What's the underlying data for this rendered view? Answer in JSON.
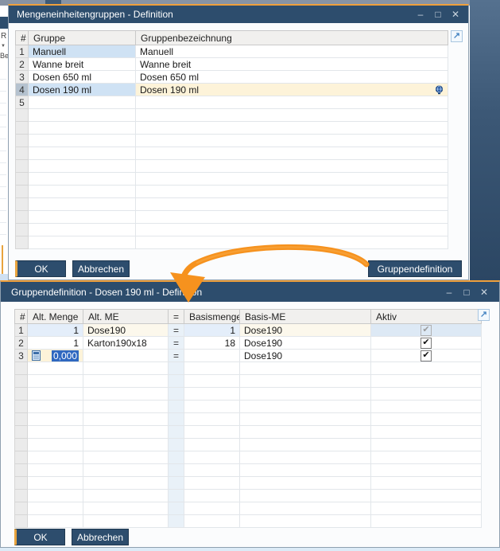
{
  "colors": {
    "accent_orange": "#EFA03C",
    "title_blue": "#2D4D6D",
    "selection_blue": "#2F68C0",
    "arrow_orange": "#F6921E"
  },
  "icons": {
    "minimize": "–",
    "maximize": "□",
    "close": "✕",
    "expand": "↗",
    "check": "✔",
    "dropdown": "▼"
  },
  "background_sliver": {
    "field_text": "R",
    "label_fragment": "Be"
  },
  "window1": {
    "title": "Mengeneinheitengruppen - Definition",
    "table": {
      "headers": {
        "num": "#",
        "gruppe": "Gruppe",
        "bezeichnung": "Gruppenbezeichnung"
      },
      "rows": [
        {
          "num": "1",
          "gruppe": "Manuell",
          "bezeichnung": "Manuell"
        },
        {
          "num": "2",
          "gruppe": "Wanne breit",
          "bezeichnung": "Wanne breit"
        },
        {
          "num": "3",
          "gruppe": "Dosen 650 ml",
          "bezeichnung": "Dosen 650 ml"
        },
        {
          "num": "4",
          "gruppe": "Dosen 190 ml",
          "bezeichnung": "Dosen 190 ml"
        },
        {
          "num": "5",
          "gruppe": "",
          "bezeichnung": ""
        }
      ],
      "empty_row_count": 11
    },
    "buttons": {
      "ok": "OK",
      "cancel": "Abbrechen",
      "group_definition": "Gruppendefinition"
    }
  },
  "window2": {
    "title": "Gruppendefinition - Dosen 190 ml - Definition",
    "table": {
      "headers": {
        "num": "#",
        "alt_menge": "Alt. Menge",
        "alt_me": "Alt. ME",
        "eq": "=",
        "basismenge": "Basismenge",
        "basis_me": "Basis-ME",
        "aktiv": "Aktiv"
      },
      "rows": [
        {
          "num": "1",
          "alt_menge": "1",
          "alt_me": "Dose190",
          "eq": "=",
          "basismenge": "1",
          "basis_me": "Dose190",
          "aktiv": "checked-disabled"
        },
        {
          "num": "2",
          "alt_menge": "1",
          "alt_me": "Karton190x18",
          "eq": "=",
          "basismenge": "18",
          "basis_me": "Dose190",
          "aktiv": "checked"
        },
        {
          "num": "3",
          "alt_menge": "0,000",
          "alt_me": "",
          "eq": "=",
          "basismenge": "",
          "basis_me": "Dose190",
          "aktiv": "checked"
        }
      ],
      "empty_row_count": 13
    },
    "buttons": {
      "ok": "OK",
      "cancel": "Abbrechen"
    }
  }
}
